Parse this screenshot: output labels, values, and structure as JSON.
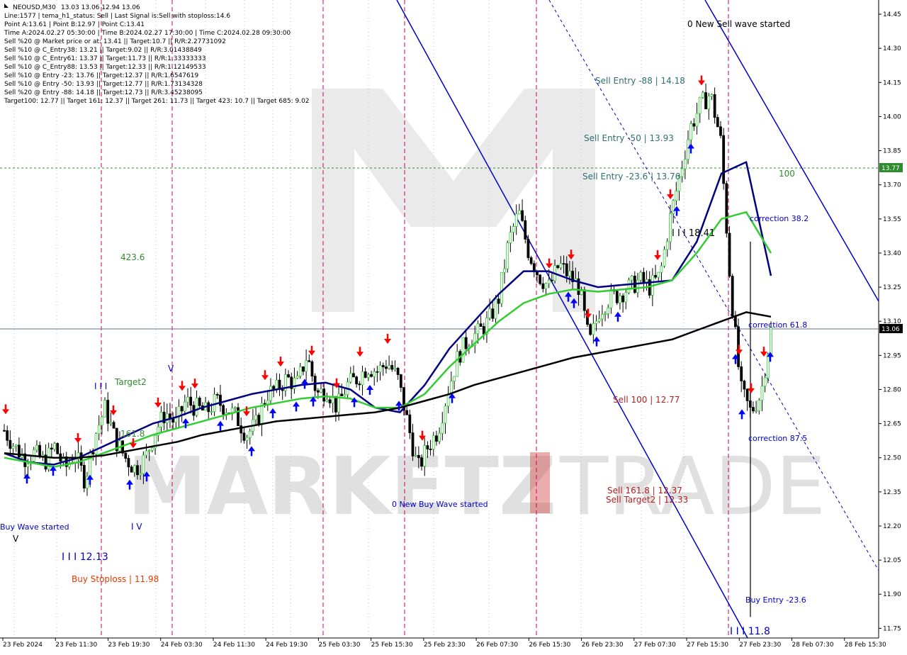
{
  "symbol_header": {
    "symbol": "NEOUSD,M30",
    "ohlc": "13.03 13.06 12.94 13.06"
  },
  "info_lines": [
    "Line:1577 | tema_h1_status: Sell | Last Signal is:Sell with stoploss:14.6",
    "Point A:13.61 | Point B:12.97 | Point C:13.41",
    "Time A:2024.02.27 05:30:00 | Time B:2024.02.27 17:30:00 | Time C:2024.02.28 09:30:00",
    "Sell %20 @ Market price or at: 13.41 || Target:10.7 || R/R:2.27731092",
    "Sell %10 @ C_Entry38: 13.21 || Target:9.02 || R/R:3.01438849",
    "Sell %10 @ C_Entry61: 13.37 || Target:11.73 || R/R:1.33333333",
    "Sell %10 @ C_Entry88: 13.53 || Target:12.33 || R/R:1.12149533",
    "Sell %10 @ Entry -23: 13.76 || Target:12.37 || R/R:1.6547619",
    "Sell %10 @ Entry -50: 13.93 || Target:12.77 || R/R:1.73134328",
    "Sell %20 @ Entry -88: 14.18 || Target:12.73 || R/R:3.45238095",
    "Target100: 12.77 || Target 161: 12.37 || Target 261: 11.73 || Target 423: 10.7 || Target 685: 9.02"
  ],
  "annotations": {
    "new_sell_wave": "0 New Sell wave started",
    "sell_entry_88": "Sell Entry -88 | 14.18",
    "sell_entry_50": "Sell Entry -50 | 13.93",
    "sell_entry_236": "Sell Entry -23.6 | 13.76",
    "label_100": "100",
    "correction_382": "correction 38.2",
    "wave_iii_1841": "I I I 18.41",
    "label_4236": "423.6",
    "correction_618": "correction 61.8",
    "target2": "Target2",
    "wave_iii_top": "I I I",
    "fib_1618": "161.8",
    "sell_100": "Sell 100 | 12.77",
    "correction_875": "correction 87.5",
    "sell_1618": "Sell 161.8 | 12.37",
    "sell_target2": "Sell Target2 | 12.33",
    "new_buy_wave": "0 New Buy Wave started",
    "buy_wave_started": "Buy Wave started",
    "wave_v": "V",
    "wave_iv": "I V",
    "wave_v_top": "V",
    "wave_iii_1213": "I I I 12.13",
    "buy_stoploss": "Buy Stoploss | 11.98",
    "buy_entry_236": "Buy Entry -23.6",
    "wave_iii_118": "I I I 11.8"
  },
  "watermark": {
    "brand_left": "MARKETZ",
    "brand_right": "TRADE"
  },
  "price_axis": {
    "current_price": "13.06",
    "level_price": "13.77",
    "current_price_color": "#000000",
    "level_price_color": "#2e8b2e"
  },
  "colors": {
    "sell_text": "#b22222",
    "buy_text": "#0000cd",
    "fib_green": "#2e8b2e",
    "entry_teal": "#2f6f6f",
    "channel_blue": "#0000cd",
    "ema_green": "#33cc33",
    "ema_navy": "#000080",
    "ema_black": "#000000",
    "session_magenta": "#cc0066"
  },
  "chart_data": {
    "type": "candlestick",
    "x_ticks": [
      "23 Feb 2024",
      "23 Feb 11:30",
      "23 Feb 19:30",
      "24 Feb 03:30",
      "24 Feb 11:30",
      "24 Feb 19:30",
      "25 Feb 03:30",
      "25 Feb 15:30",
      "25 Feb 23:30",
      "26 Feb 07:30",
      "26 Feb 15:30",
      "26 Feb 23:30",
      "27 Feb 07:30",
      "27 Feb 15:30",
      "27 Feb 23:30",
      "28 Feb 07:30",
      "28 Feb 15:30"
    ],
    "y_ticks": [
      "14.45",
      "14.30",
      "14.15",
      "14.00",
      "13.85",
      "13.70",
      "13.55",
      "13.40",
      "13.25",
      "13.10",
      "12.95",
      "12.80",
      "12.65",
      "12.50",
      "12.35",
      "12.20",
      "12.05",
      "11.90",
      "11.75"
    ],
    "ylim": [
      11.72,
      14.5
    ],
    "price_path": [
      12.62,
      12.55,
      12.5,
      12.52,
      12.48,
      12.55,
      12.45,
      12.52,
      12.4,
      12.6,
      12.72,
      12.58,
      12.5,
      12.45,
      12.5,
      12.62,
      12.7,
      12.65,
      12.75,
      12.72,
      12.7,
      12.75,
      12.72,
      12.68,
      12.6,
      12.65,
      12.78,
      12.8,
      12.85,
      12.82,
      12.95,
      12.78,
      12.8,
      12.72,
      12.82,
      12.85,
      12.9,
      12.88,
      12.92,
      12.85,
      12.65,
      12.45,
      12.55,
      12.62,
      12.8,
      12.95,
      13.02,
      13.05,
      13.1,
      13.2,
      13.45,
      13.58,
      13.4,
      13.3,
      13.25,
      13.35,
      13.3,
      13.25,
      13.0,
      13.15,
      13.2,
      13.22,
      13.25,
      13.28,
      13.25,
      13.3,
      13.55,
      13.75,
      13.95,
      14.05,
      14.1,
      13.9,
      13.25,
      12.8,
      12.7,
      12.78,
      13.06
    ],
    "moving_averages": [
      {
        "name": "ema_fast",
        "color": "#000080",
        "values": [
          12.52,
          12.48,
          12.47,
          12.5,
          12.55,
          12.6,
          12.65,
          12.68,
          12.72,
          12.75,
          12.78,
          12.8,
          12.82,
          12.83,
          12.8,
          12.72,
          12.7,
          12.82,
          12.98,
          13.1,
          13.22,
          13.32,
          13.32,
          13.28,
          13.25,
          13.26,
          13.27,
          13.28,
          13.45,
          13.75,
          13.8,
          13.3
        ]
      },
      {
        "name": "ema_mid",
        "color": "#33cc33",
        "values": [
          12.5,
          12.48,
          12.46,
          12.48,
          12.52,
          12.56,
          12.6,
          12.63,
          12.66,
          12.69,
          12.72,
          12.74,
          12.76,
          12.77,
          12.76,
          12.72,
          12.72,
          12.78,
          12.9,
          13.0,
          13.1,
          13.18,
          13.22,
          13.24,
          13.23,
          13.24,
          13.25,
          13.28,
          13.4,
          13.55,
          13.58,
          13.4
        ]
      },
      {
        "name": "ema_slow",
        "color": "#000000",
        "values": [
          12.52,
          12.51,
          12.5,
          12.5,
          12.51,
          12.53,
          12.55,
          12.57,
          12.6,
          12.62,
          12.64,
          12.66,
          12.67,
          12.68,
          12.69,
          12.7,
          12.72,
          12.75,
          12.78,
          12.82,
          12.85,
          12.88,
          12.91,
          12.94,
          12.96,
          12.98,
          13.0,
          13.02,
          13.06,
          13.1,
          13.14,
          13.12
        ]
      }
    ]
  }
}
